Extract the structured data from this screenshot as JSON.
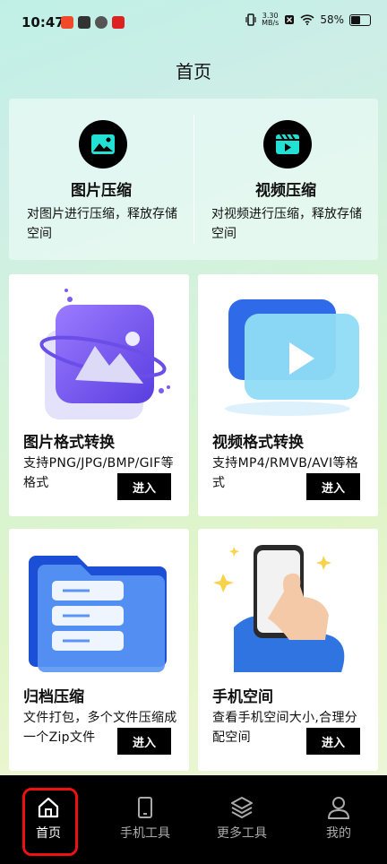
{
  "status": {
    "time": "10:47",
    "net_speed": "3.30",
    "net_unit": "MB/s",
    "battery": "58%",
    "battery_level": 58
  },
  "header": {
    "title": "首页"
  },
  "top_features": [
    {
      "title": "图片压缩",
      "desc": "对图片进行压缩，释放存储空间",
      "icon": "image-icon"
    },
    {
      "title": "视频压缩",
      "desc": "对视频进行压缩，释放存储空间",
      "icon": "video-icon"
    }
  ],
  "cards": [
    {
      "title": "图片格式转换",
      "desc": "支持PNG/JPG/BMP/GIF等格式",
      "button": "进入"
    },
    {
      "title": "视频格式转换",
      "desc": "支持MP4/RMVB/AVI等格式",
      "button": "进入"
    },
    {
      "title": "归档压缩",
      "desc": "文件打包，多个文件压缩成一个Zip文件",
      "button": "进入"
    },
    {
      "title": "手机空间",
      "desc": "查看手机空间大小,合理分配空间",
      "button": "进入"
    }
  ],
  "tabs": [
    {
      "label": "首页",
      "icon": "home-icon",
      "active": true
    },
    {
      "label": "手机工具",
      "icon": "phone-icon",
      "active": false
    },
    {
      "label": "更多工具",
      "icon": "layers-icon",
      "active": false
    },
    {
      "label": "我的",
      "icon": "user-icon",
      "active": false
    }
  ],
  "colors": {
    "accent_cyan": "#23e0d5",
    "tab_bg": "#000000",
    "highlight": "#e11111"
  }
}
